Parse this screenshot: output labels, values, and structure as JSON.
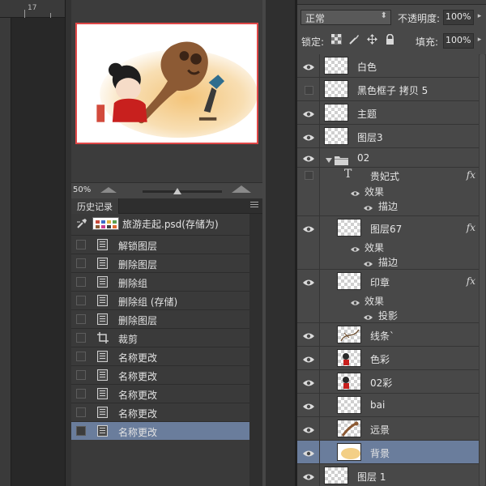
{
  "ruler": {
    "label": "17"
  },
  "navigator": {
    "zoom": "50%"
  },
  "history": {
    "tab_label": "历史记录",
    "snapshot_label": "旅游走起.psd(存储为)",
    "items": [
      {
        "label": "解锁图层",
        "icon": "document-icon",
        "selected": false
      },
      {
        "label": "删除图层",
        "icon": "document-icon",
        "selected": false
      },
      {
        "label": "删除组",
        "icon": "document-icon",
        "selected": false
      },
      {
        "label": "删除组 (存储)",
        "icon": "document-icon",
        "selected": false
      },
      {
        "label": "删除图层",
        "icon": "document-icon",
        "selected": false
      },
      {
        "label": "裁剪",
        "icon": "crop-icon",
        "selected": false
      },
      {
        "label": "名称更改",
        "icon": "document-icon",
        "selected": false
      },
      {
        "label": "名称更改",
        "icon": "document-icon",
        "selected": false
      },
      {
        "label": "名称更改",
        "icon": "document-icon",
        "selected": false
      },
      {
        "label": "名称更改",
        "icon": "document-icon",
        "selected": false
      },
      {
        "label": "名称更改",
        "icon": "document-icon",
        "selected": true
      }
    ]
  },
  "layers": {
    "blend_mode": "正常",
    "opacity_label": "不透明度:",
    "opacity_value": "100%",
    "lock_label": "锁定:",
    "fill_label": "填充:",
    "fill_value": "100%",
    "items": [
      {
        "kind": "layer",
        "name": "白色",
        "visible": true,
        "indent": 0,
        "thumb": "blank"
      },
      {
        "kind": "layer",
        "name": "黑色框子 拷贝 5",
        "visible": false,
        "indent": 0,
        "thumb": "blank"
      },
      {
        "kind": "layer",
        "name": "主题",
        "visible": true,
        "indent": 0,
        "thumb": "blank"
      },
      {
        "kind": "layer",
        "name": "图层3",
        "visible": true,
        "indent": 0,
        "thumb": "blank"
      },
      {
        "kind": "group",
        "name": "02",
        "visible": true
      },
      {
        "kind": "text",
        "name": "贵妃式",
        "visible": false,
        "fx": "fx",
        "effects_label": "效果",
        "effects": [
          "描边"
        ]
      },
      {
        "kind": "layer",
        "name": "图层67",
        "visible": true,
        "indent": 1,
        "thumb": "blank",
        "fx": "fx",
        "effects_label": "效果",
        "effects": [
          "描边"
        ]
      },
      {
        "kind": "layer",
        "name": "印章",
        "visible": true,
        "indent": 1,
        "thumb": "blank",
        "fx": "fx",
        "effects_label": "效果",
        "effects": [
          "投影"
        ]
      },
      {
        "kind": "layer",
        "name": "线条`",
        "visible": true,
        "indent": 1,
        "thumb": "lines"
      },
      {
        "kind": "layer",
        "name": "色彩",
        "visible": true,
        "indent": 1,
        "thumb": "figure"
      },
      {
        "kind": "layer",
        "name": "02彩",
        "visible": true,
        "indent": 1,
        "thumb": "figure"
      },
      {
        "kind": "layer",
        "name": "bai",
        "visible": true,
        "indent": 1,
        "thumb": "blank"
      },
      {
        "kind": "layer",
        "name": "远景",
        "visible": true,
        "indent": 1,
        "thumb": "scenery"
      },
      {
        "kind": "layer",
        "name": "背景",
        "visible": true,
        "indent": 1,
        "thumb": "yellow",
        "selected": true
      },
      {
        "kind": "layer",
        "name": "图层 1",
        "visible": true,
        "indent": 0,
        "thumb": "white"
      }
    ]
  },
  "colors": {
    "accent_selection": "#6a7d9c",
    "navigator_frame": "#e04848"
  }
}
